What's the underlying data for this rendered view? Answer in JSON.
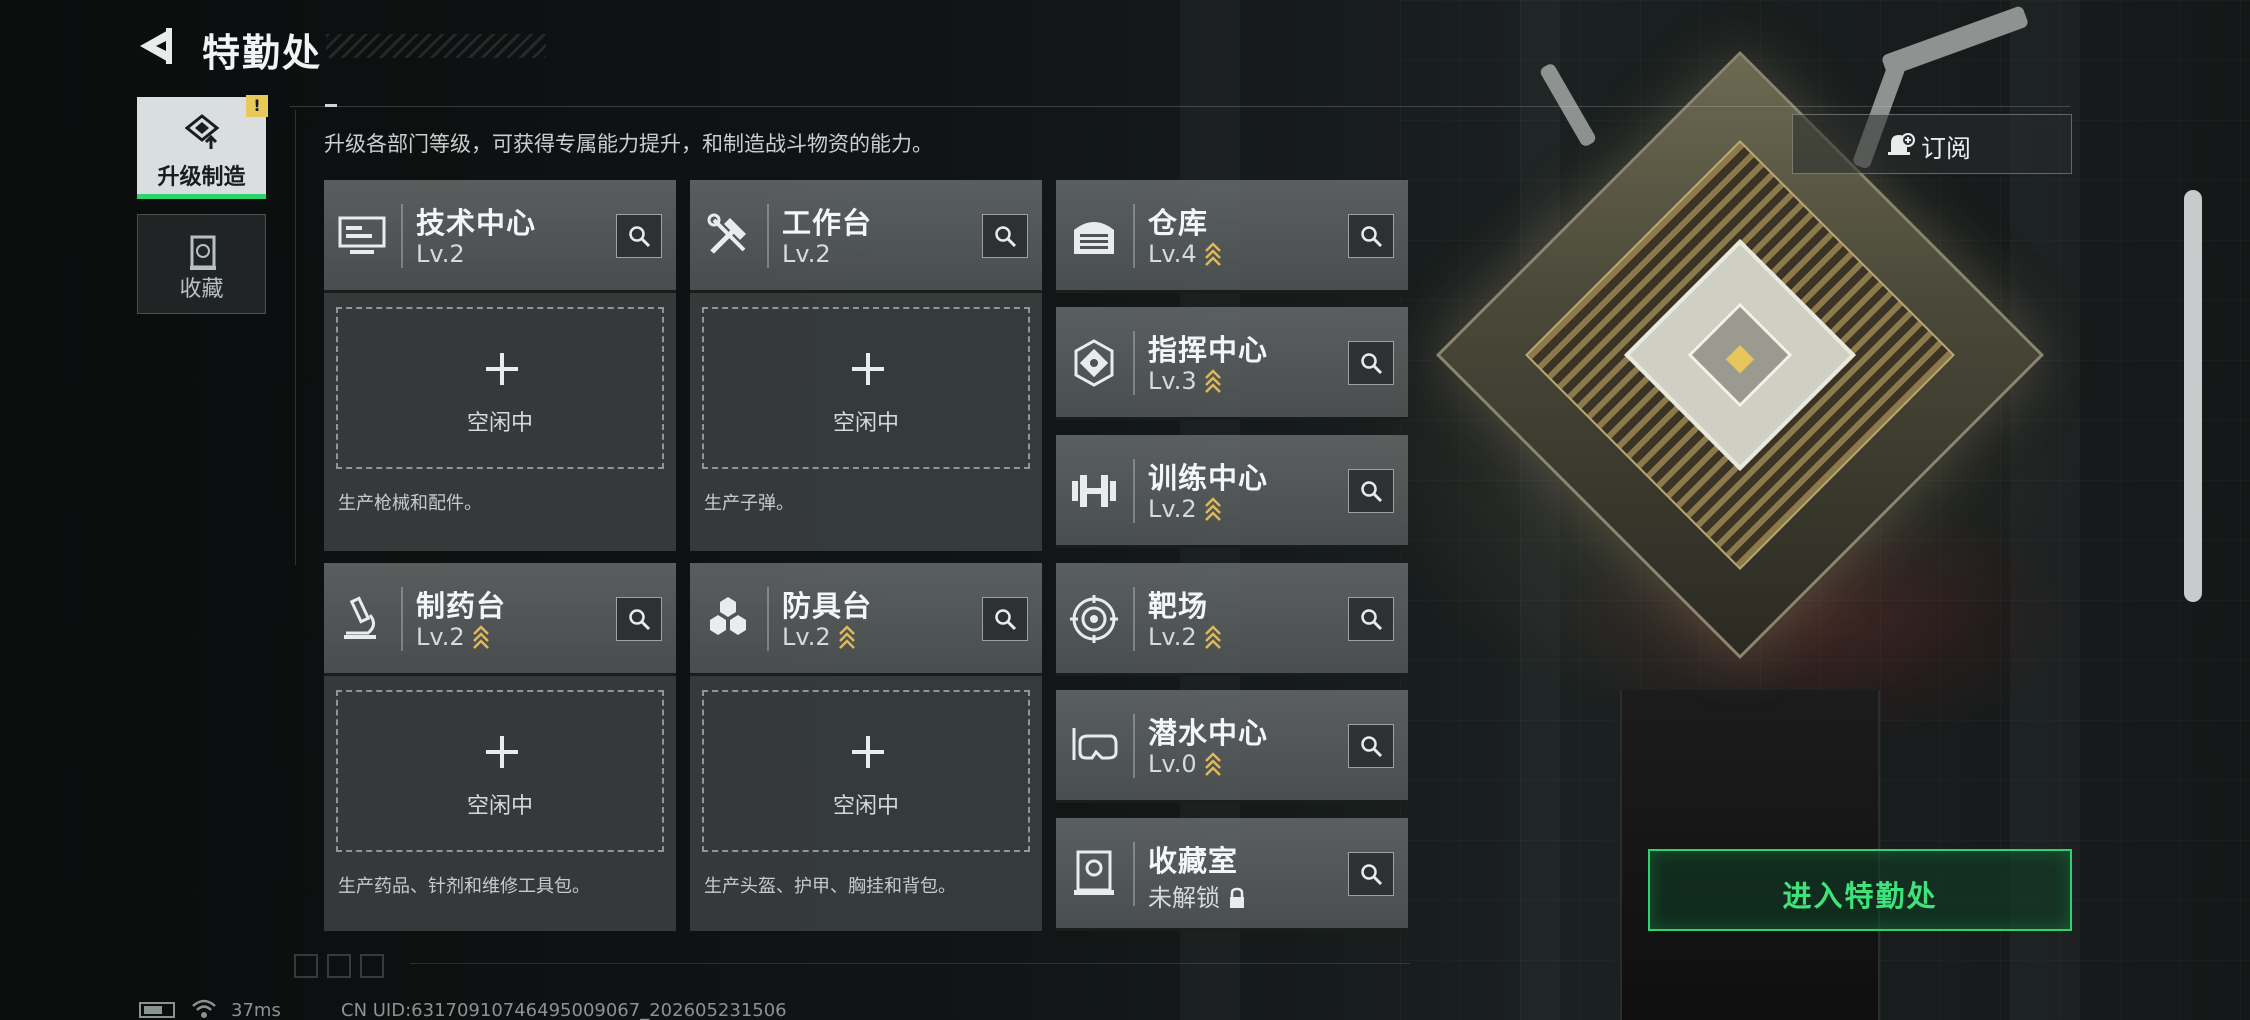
{
  "header": {
    "title": "特勤处",
    "back_icon": "back-arrow-icon"
  },
  "nav": {
    "items": [
      {
        "label": "升级制造",
        "icon": "upgrade-build-icon",
        "active": true,
        "alert": "!"
      },
      {
        "label": "收藏",
        "icon": "collection-icon",
        "active": false
      }
    ]
  },
  "description": "升级各部门等级，可获得专属能力提升，和制造战斗物资的能力。",
  "subscribe": {
    "label": "订阅",
    "icon": "bell-plus-icon"
  },
  "production_facilities": [
    {
      "name": "技术中心",
      "level": "Lv.2",
      "icon": "computer-icon",
      "status": "空闲中",
      "produces": "生产枪械和配件。"
    },
    {
      "name": "工作台",
      "level": "Lv.2",
      "icon": "tools-icon",
      "status": "空闲中",
      "produces": "生产子弹。"
    },
    {
      "name": "制药台",
      "level": "Lv.2",
      "icon": "microscope-icon",
      "status": "空闲中",
      "produces": "生产药品、针剂和维修工具包。"
    },
    {
      "name": "防具台",
      "level": "Lv.2",
      "icon": "hexagons-icon",
      "status": "空闲中",
      "produces": "生产头盔、护甲、胸挂和背包。"
    }
  ],
  "other_facilities": [
    {
      "name": "仓库",
      "level": "Lv.4",
      "icon": "warehouse-icon",
      "upgradable": true
    },
    {
      "name": "指挥中心",
      "level": "Lv.3",
      "icon": "command-chip-icon",
      "upgradable": true
    },
    {
      "name": "训练中心",
      "level": "Lv.2",
      "icon": "dumbbell-icon",
      "upgradable": true
    },
    {
      "name": "靶场",
      "level": "Lv.2",
      "icon": "target-icon",
      "upgradable": true
    },
    {
      "name": "潜水中心",
      "level": "Lv.0",
      "icon": "diving-mask-icon",
      "upgradable": true
    },
    {
      "name": "收藏室",
      "level": "未解锁",
      "icon": "vault-icon",
      "upgradable": false,
      "locked": true
    }
  ],
  "enter_button": {
    "label": "进入特勤处"
  },
  "status_bar": {
    "ping": "37ms",
    "uid": "CN UID:63170910746495009067_202605231506"
  },
  "colors": {
    "accent_green": "#2fd36d",
    "upgrade_chevron": "#e0b85a",
    "alert_yellow": "#e8c95a"
  }
}
